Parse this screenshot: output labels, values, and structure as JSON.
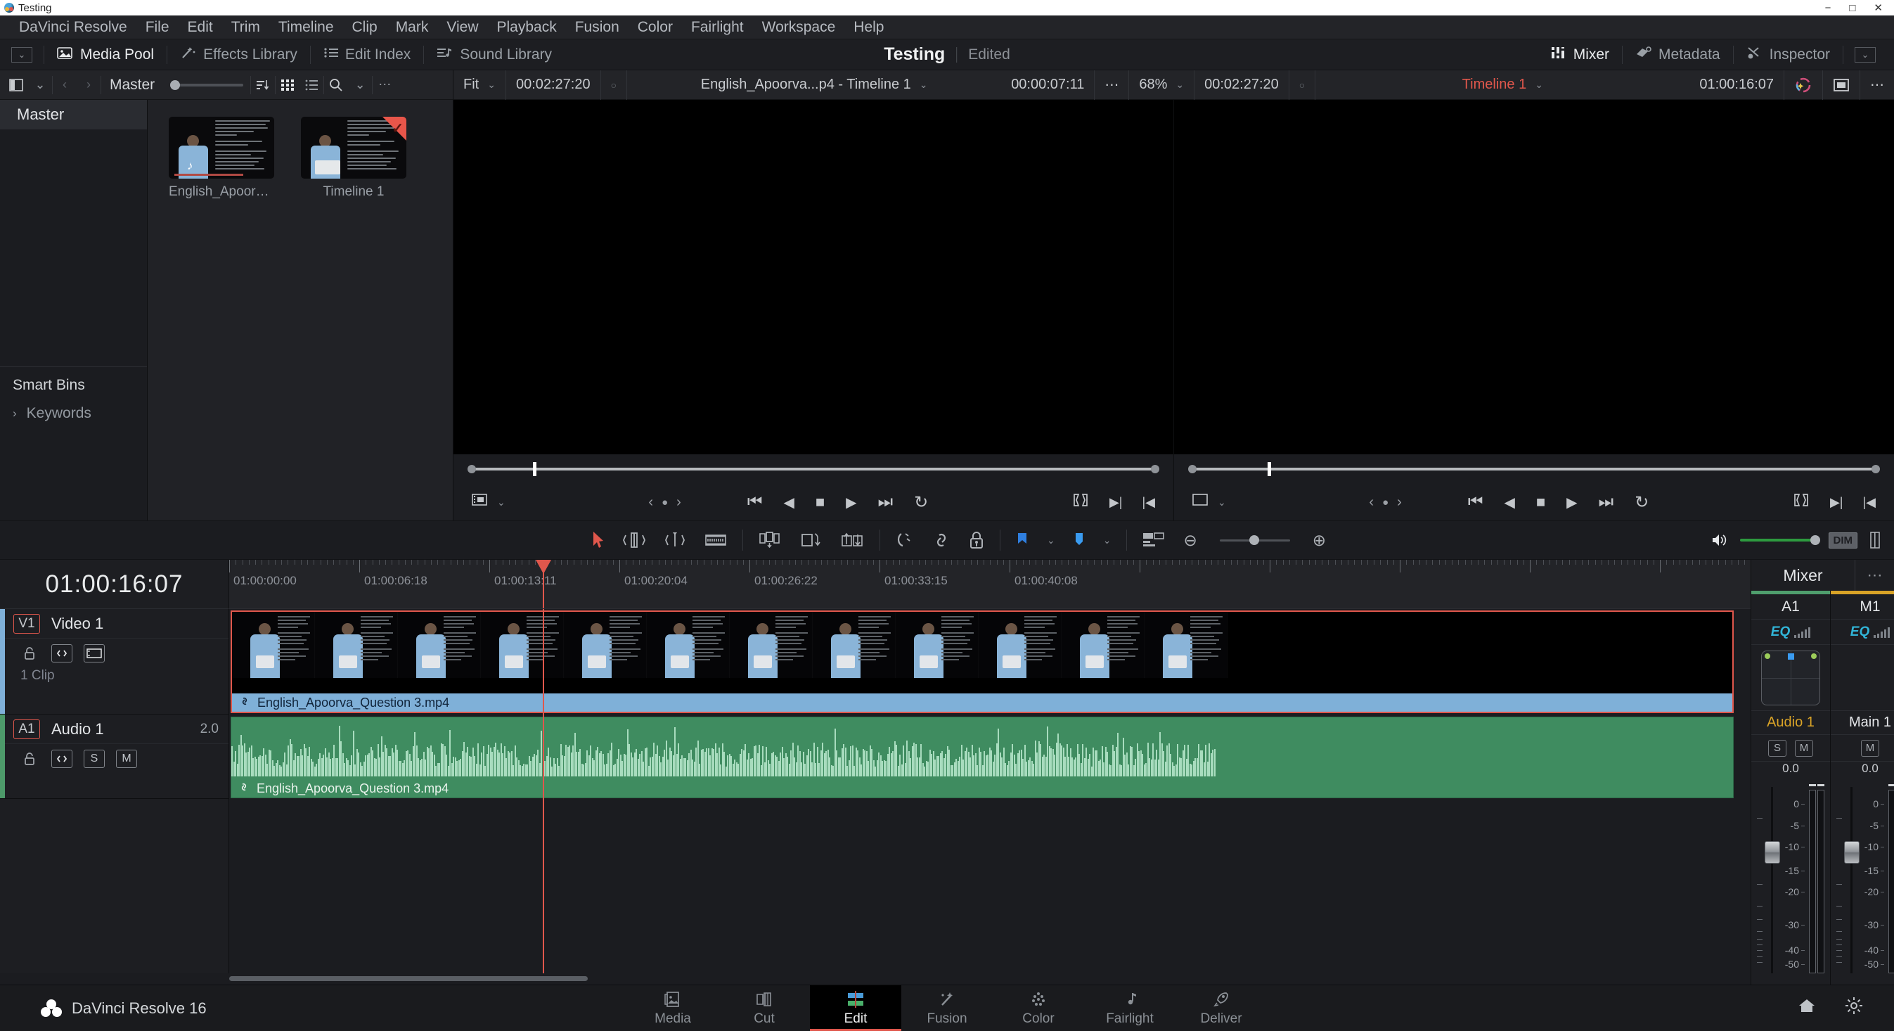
{
  "window": {
    "title": "Testing",
    "minimize": "−",
    "maximize": "□",
    "close": "✕"
  },
  "menubar": {
    "items": [
      "DaVinci Resolve",
      "File",
      "Edit",
      "Trim",
      "Timeline",
      "Clip",
      "Mark",
      "View",
      "Playback",
      "Fusion",
      "Color",
      "Fairlight",
      "Workspace",
      "Help"
    ]
  },
  "toolbar": {
    "left_chevron": "⌄",
    "buttons": [
      {
        "label": "Media Pool",
        "icon": "media-pool-icon",
        "active": true
      },
      {
        "label": "Effects Library",
        "icon": "effects-library-icon",
        "active": false
      },
      {
        "label": "Edit Index",
        "icon": "edit-index-icon",
        "active": false
      },
      {
        "label": "Sound Library",
        "icon": "sound-library-icon",
        "active": false
      }
    ],
    "project_name": "Testing",
    "project_state": "Edited",
    "right_buttons": [
      {
        "label": "Mixer",
        "icon": "mixer-icon",
        "active": true
      },
      {
        "label": "Metadata",
        "icon": "metadata-icon",
        "active": false
      },
      {
        "label": "Inspector",
        "icon": "inspector-icon",
        "active": false
      }
    ],
    "right_chevron": "⌄"
  },
  "media_pool": {
    "toolbar": {
      "panel_icon": "split-panel-icon",
      "chevron": "⌄",
      "back": "‹",
      "forward": "›",
      "bin_label": "Master",
      "sort_icon": "sort-icon",
      "grid_icon": "grid-view-icon",
      "list_icon": "list-view-icon",
      "search_icon": "search-icon",
      "search_chevron": "⌄",
      "options_icon": "⋯"
    },
    "tree": {
      "master": "Master",
      "smart_bins": "Smart Bins",
      "keywords": "Keywords",
      "keywords_arrow": "›"
    },
    "clips": [
      {
        "name": "English_Apoorva_...",
        "type": "video",
        "selected": false
      },
      {
        "name": "Timeline 1",
        "type": "timeline",
        "selected": true
      }
    ]
  },
  "source_viewer": {
    "zoom_fit": "Fit",
    "zoom_chevron": "⌄",
    "duration": "00:02:27:20",
    "marker_dot": "○",
    "title": "English_Apoorva...p4 - Timeline 1",
    "title_chevron": "⌄",
    "current_tc": "00:00:07:11",
    "options": "⋯"
  },
  "timeline_viewer": {
    "zoom_level": "68%",
    "zoom_chevron": "⌄",
    "duration": "00:02:27:20",
    "marker_dot": "○",
    "name": "Timeline 1",
    "name_chevron": "⌄",
    "current_tc": "01:00:16:07",
    "color_icon": "color-wheel-icon",
    "frame_icon": "safe-area-icon",
    "options": "⋯"
  },
  "transport": {
    "frame_icon": "frame-mode-icon",
    "chevron": "⌄",
    "nudge_left": "‹",
    "nudge_dot": "●",
    "nudge_right": "›",
    "fast_back": "⏮",
    "play_back": "◀",
    "stop": "■",
    "play": "▶",
    "fast_forward": "⏭",
    "loop": "↻",
    "in_out": "in-out-icon",
    "mark_out": "▶|",
    "mark_in": "|◀"
  },
  "edit_toolbar": {
    "tools": [
      {
        "name": "selection-tool",
        "glyph": "➤",
        "color": "red"
      },
      {
        "name": "trim-edit-tool",
        "glyph": "trim"
      },
      {
        "name": "dynamic-trim-tool",
        "glyph": "dyntrim"
      },
      {
        "name": "razor-tool",
        "glyph": "razor"
      },
      {
        "name": "snapping-tool",
        "glyph": "snap"
      },
      {
        "name": "flags-tool",
        "glyph": "flag"
      },
      {
        "name": "markers-tool",
        "glyph": "marker"
      },
      {
        "name": "position-lock",
        "glyph": "lock"
      },
      {
        "name": "flag-color",
        "glyph": "flagblue"
      },
      {
        "name": "marker-color",
        "glyph": "markerblue"
      },
      {
        "name": "audio-overlay",
        "glyph": "audio"
      },
      {
        "name": "zoom-out",
        "glyph": "⊖"
      },
      {
        "name": "zoom-in",
        "glyph": "⊕"
      }
    ],
    "volume_icon": "speaker-icon",
    "dim_label": "DIM",
    "panel_icon": "panel-icon"
  },
  "timeline": {
    "current_timecode": "01:00:16:07",
    "ruler_labels": [
      "01:00:00:00",
      "01:00:06:18",
      "01:00:13:11",
      "01:00:20:04",
      "01:00:26:22",
      "01:00:33:15",
      "01:00:40:08"
    ],
    "tracks": [
      {
        "badge": "V1",
        "name": "Video 1",
        "clip_count": "1 Clip",
        "controls": [
          "lock-icon",
          "auto-select-icon",
          "thumbnail-icon"
        ],
        "clip_name": "English_Apoorva_Question 3.mp4",
        "link_icon": "link-icon"
      },
      {
        "badge": "A1",
        "name": "Audio 1",
        "channels": "2.0",
        "controls": [
          "lock-icon",
          "auto-select-icon",
          "S",
          "M"
        ],
        "clip_name": "English_Apoorva_Question 3.mp4",
        "link_icon": "link-icon"
      }
    ]
  },
  "mixer": {
    "title": "Mixer",
    "options": "⋯",
    "strips": [
      {
        "id": "A1",
        "eq": "EQ",
        "track_name": "Audio 1",
        "buttons": [
          "S",
          "M"
        ],
        "value": "0.0",
        "color": "#4f9e6d",
        "has_pan": true
      },
      {
        "id": "M1",
        "eq": "EQ",
        "track_name": "Main 1",
        "buttons": [
          "M"
        ],
        "value": "0.0",
        "color": "#d9a327",
        "has_pan": false
      }
    ],
    "fader_scale": [
      "0",
      "-5",
      "-10",
      "-15",
      "-20",
      "-30",
      "-40",
      "-50"
    ]
  },
  "bottom_bar": {
    "app_name": "DaVinci Resolve 16",
    "pages": [
      {
        "label": "Media",
        "icon": "media-page-icon",
        "active": false
      },
      {
        "label": "Cut",
        "icon": "cut-page-icon",
        "active": false
      },
      {
        "label": "Edit",
        "icon": "edit-page-icon",
        "active": true
      },
      {
        "label": "Fusion",
        "icon": "fusion-page-icon",
        "active": false
      },
      {
        "label": "Color",
        "icon": "color-page-icon",
        "active": false
      },
      {
        "label": "Fairlight",
        "icon": "fairlight-page-icon",
        "active": false
      },
      {
        "label": "Deliver",
        "icon": "deliver-page-icon",
        "active": false
      }
    ],
    "home_icon": "home-icon",
    "settings_icon": "settings-icon"
  },
  "colors": {
    "accent_red": "#e0574c",
    "video_track": "#7fb0d8",
    "audio_track": "#3f8c60",
    "mixer_green": "#4f9e6d",
    "mixer_amber": "#d9a327"
  }
}
